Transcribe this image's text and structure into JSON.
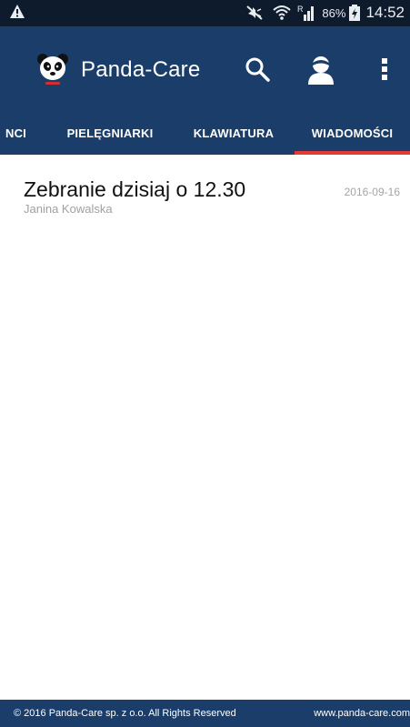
{
  "status_bar": {
    "battery_percent": "86%",
    "time": "14:52",
    "icons": [
      "warning-icon",
      "mute-icon",
      "wifi-icon",
      "signal-roaming-icon",
      "battery-charging-icon"
    ]
  },
  "app_bar": {
    "title": "Panda-Care",
    "color": "#1a3d6a",
    "icons": [
      "panda-logo-icon",
      "search-icon",
      "profile-avatar-icon",
      "overflow-menu-icon"
    ]
  },
  "tabs": {
    "items": [
      {
        "label": "NCI",
        "selected": false
      },
      {
        "label": "PIELĘGNIARKI",
        "selected": false
      },
      {
        "label": "KLAWIATURA",
        "selected": false
      },
      {
        "label": "WIADOMOŚCI",
        "selected": true
      }
    ],
    "indicator_color": "#e53935"
  },
  "messages": [
    {
      "subject": "Zebranie dzisiaj o 12.30",
      "sender": "Janina Kowalska",
      "date": "2016-09-16"
    }
  ],
  "footer": {
    "copyright": "© 2016 Panda-Care sp. z o.o. All Rights Reserved",
    "url": "www.panda-care.com"
  }
}
